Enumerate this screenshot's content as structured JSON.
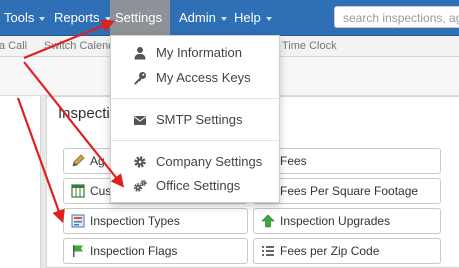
{
  "navbar": {
    "items": [
      {
        "label": "Tools"
      },
      {
        "label": "Reports"
      },
      {
        "label": "Settings"
      },
      {
        "label": "Admin"
      },
      {
        "label": "Help"
      }
    ],
    "search_placeholder": "search inspections, age"
  },
  "subbar": {
    "items": [
      {
        "label": "a Call"
      },
      {
        "label": "Switch Calend"
      },
      {
        "label": "Time Clock"
      }
    ]
  },
  "panel": {
    "title": "Inspectio",
    "buttons": [
      {
        "label": "Ag",
        "icon": "pencil-icon"
      },
      {
        "label": "Fees",
        "icon": "list-icon"
      },
      {
        "label": "Cus",
        "icon": "table-icon"
      },
      {
        "label": "Fees Per Square Footage",
        "icon": "list-icon"
      },
      {
        "label": "Inspection Types",
        "icon": "form-icon"
      },
      {
        "label": "Inspection Upgrades",
        "icon": "arrow-up-icon"
      },
      {
        "label": "Inspection Flags",
        "icon": "flag-icon"
      },
      {
        "label": "Fees per Zip Code",
        "icon": "list-icon"
      }
    ]
  },
  "menu": {
    "items": [
      {
        "label": "My Information",
        "icon": "user-icon"
      },
      {
        "label": "My Access Keys",
        "icon": "key-icon"
      },
      {
        "label": "SMTP Settings",
        "icon": "envelope-icon"
      },
      {
        "label": "Company Settings",
        "icon": "gear-icon"
      },
      {
        "label": "Office Settings",
        "icon": "gears-icon"
      }
    ]
  },
  "colors": {
    "navbar": "#2f6fb5",
    "active_menu": "#8e9298",
    "annotation_arrow": "#e02020"
  }
}
